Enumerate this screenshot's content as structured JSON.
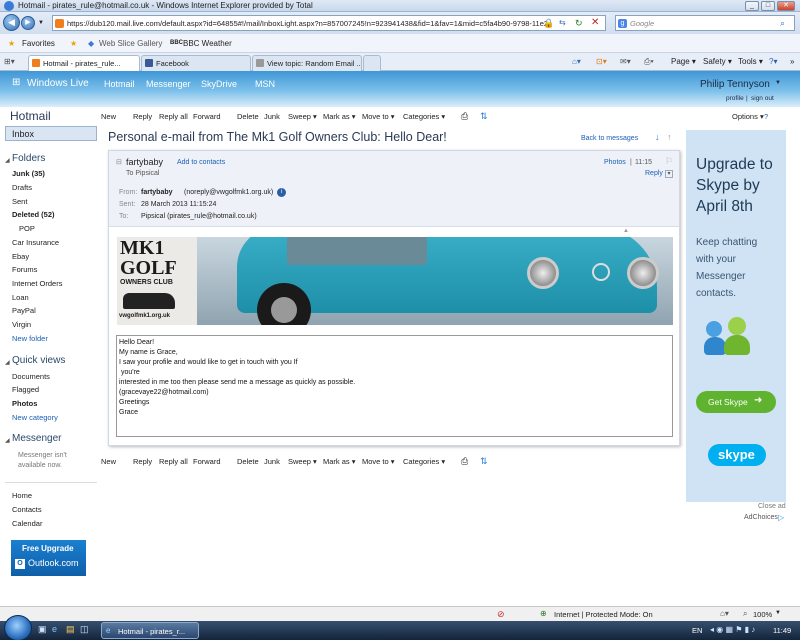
{
  "window": {
    "title": "Hotmail - pirates_rule@hotmail.co.uk - Windows Internet Explorer provided by Total"
  },
  "address": {
    "url": "https://dub120.mail.live.com/default.aspx?id=64855#!/mail/InboxLight.aspx?n=857007245!n=923941438&fid=1&fav=1&mid=c5fa4b90-9798-11e2-",
    "search_placeholder": "Google"
  },
  "favbar": {
    "favorites": "Favorites",
    "web_slice": "Web Slice Gallery",
    "bbc": "BBC Weather"
  },
  "tabs": [
    {
      "label": "Hotmail - pirates_rule..."
    },
    {
      "label": "Facebook"
    },
    {
      "label": "View topic: Random Email ..."
    }
  ],
  "ie_commands": {
    "page": "Page",
    "safety": "Safety",
    "tools": "Tools"
  },
  "live_header": {
    "brand": "Windows Live",
    "nav": [
      "Hotmail",
      "Messenger",
      "SkyDrive",
      "MSN"
    ],
    "user": "Philip Tennyson",
    "profile": "profile",
    "signout": "sign out"
  },
  "leftnav": {
    "hotmail": "Hotmail",
    "inbox": "Inbox",
    "folders_title": "Folders",
    "folders": [
      {
        "label": "Junk (35)",
        "bold": true
      },
      {
        "label": "Drafts",
        "bold": false
      },
      {
        "label": "Sent",
        "bold": false
      },
      {
        "label": "Deleted (52)",
        "bold": true
      },
      {
        "label": "POP",
        "bold": false
      },
      {
        "label": "Car Insurance",
        "bold": false
      },
      {
        "label": "Ebay",
        "bold": false
      },
      {
        "label": "Forums",
        "bold": false
      },
      {
        "label": "Internet Orders",
        "bold": false
      },
      {
        "label": "Loan",
        "bold": false
      },
      {
        "label": "PayPal",
        "bold": false
      },
      {
        "label": "Virgin",
        "bold": false
      }
    ],
    "new_folder": "New folder",
    "quick_title": "Quick views",
    "quick": [
      "Documents",
      "Flagged",
      "Photos"
    ],
    "new_category": "New category",
    "messenger_title": "Messenger",
    "messenger_status": "Messenger isn't available now.",
    "bottom": [
      "Home",
      "Contacts",
      "Calendar"
    ],
    "promo_title": "Free Upgrade",
    "promo_brand": "Outlook.com"
  },
  "toolbar": {
    "items": [
      "New",
      "Reply",
      "Reply all",
      "Forward",
      "Delete",
      "Junk",
      "Sweep",
      "Mark as",
      "Move to",
      "Categories"
    ],
    "options": "Options"
  },
  "message": {
    "subject": "Personal e-mail from The Mk1 Golf Owners Club: Hello Dear!",
    "back": "Back to messages",
    "sender": "fartybaby",
    "add_contact": "Add to contacts",
    "to_short": "To Pipsical",
    "photos": "Photos",
    "time": "11:15",
    "reply": "Reply",
    "from_label": "From:",
    "from_name": "fartybaby",
    "from_email": "(noreply@vwgolfmk1.org.uk)",
    "sent_label": "Sent:",
    "sent_value": "28 March 2013 11:15:24",
    "to_label": "To:",
    "to_value": "Pipsical (pirates_rule@hotmail.co.uk)",
    "banner": {
      "line1": "MK1",
      "line2": "GOLF",
      "line3": "OWNERS CLUB",
      "url": "vwgolfmk1.org.uk"
    },
    "body": [
      "Hello Dear!",
      "",
      "My name is Grace,",
      "",
      "I saw your profile and would like to get in touch with you If",
      " you're",
      "interested in me too then please send me a message as quickly as possible.",
      "(gracevaye22@hotmail.com)",
      "Greetings",
      "Grace"
    ]
  },
  "ad": {
    "headline": "Upgrade to Skype by April 8th",
    "text": "Keep chatting with your Messenger contacts.",
    "button": "Get Skype",
    "logo": "skype",
    "close": "Close ad",
    "adchoices": "AdChoices"
  },
  "statusbar": {
    "zone": "Internet | Protected Mode: On",
    "zoom": "100%"
  },
  "taskbar": {
    "item": "Hotmail - pirates_r...",
    "lang": "EN",
    "clock": "11:49"
  },
  "colors": {
    "accent": "#1a5fb4",
    "header_blue": "#3f97d6",
    "skype_green": "#5fb32e",
    "skype_blue": "#00aff0"
  }
}
